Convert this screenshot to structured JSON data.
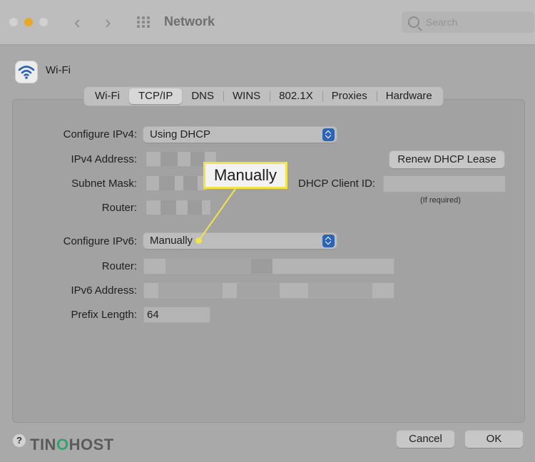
{
  "window": {
    "title": "Network",
    "search_placeholder": "Search"
  },
  "service": {
    "name": "Wi-Fi"
  },
  "tabs": [
    "Wi-Fi",
    "TCP/IP",
    "DNS",
    "WINS",
    "802.1X",
    "Proxies",
    "Hardware"
  ],
  "ipv4": {
    "configure_label": "Configure IPv4:",
    "configure_value": "Using DHCP",
    "address_label": "IPv4 Address:",
    "subnet_label": "Subnet Mask:",
    "router_label": "Router:",
    "renew_button": "Renew DHCP Lease",
    "dhcp_client_id_label": "DHCP Client ID:",
    "dhcp_client_id_hint": "(If required)"
  },
  "ipv6": {
    "configure_label": "Configure IPv6:",
    "configure_value": "Manually",
    "router_label": "Router:",
    "address_label": "IPv6 Address:",
    "prefix_label": "Prefix Length:",
    "prefix_value": "64"
  },
  "callout": {
    "text": "Manually",
    "color": "#f2e34a"
  },
  "footer": {
    "help": "?",
    "cancel": "Cancel",
    "ok": "OK"
  },
  "watermark": {
    "text": "TINOHOST"
  },
  "colors": {
    "accent": "#2d63b3",
    "highlight": "#f2e34a"
  }
}
